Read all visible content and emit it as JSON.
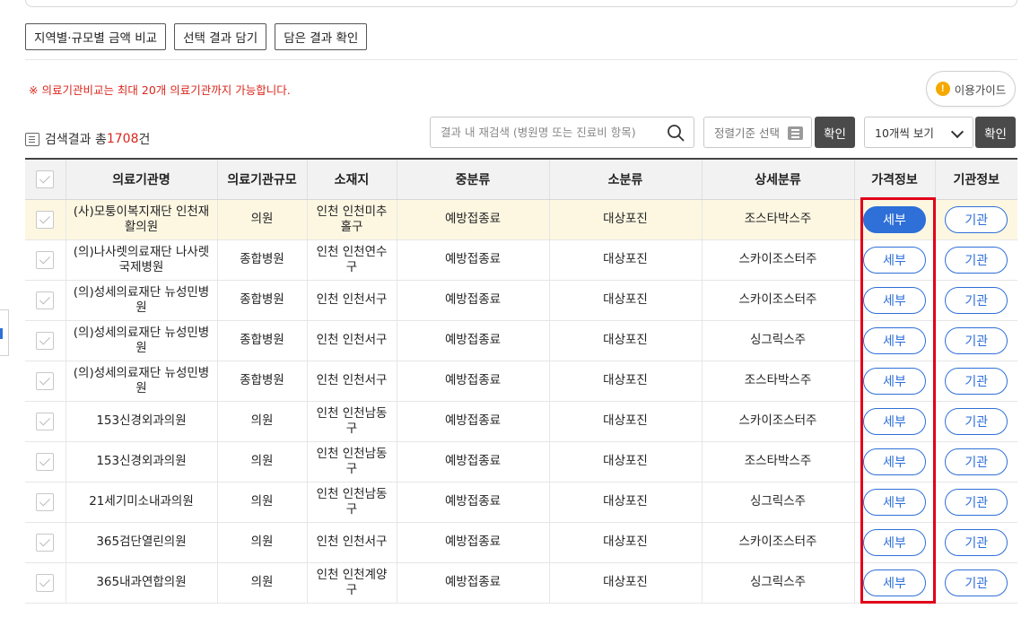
{
  "toolbar": {
    "compare_label": "지역별·규모별 금액 비교",
    "select_label": "선택 결과 담기",
    "view_label": "담은 결과 확인"
  },
  "notice": "※ 의료기관비교는 최대 20개 의료기관까지 가능합니다.",
  "guide": {
    "icon": "!",
    "label": "이용가이드"
  },
  "result": {
    "prefix": "검색결과 총",
    "count": "1708",
    "suffix": "건"
  },
  "search": {
    "placeholder": "결과 내 재검색 (병원명 또는 진료비 항목)"
  },
  "sort": {
    "placeholder": "정렬기준 선택",
    "confirm_label": "확인"
  },
  "perpage": {
    "selected": "10개씩 보기",
    "confirm_label": "확인"
  },
  "table": {
    "headers": [
      "의료기관명",
      "의료기관규모",
      "소재지",
      "중분류",
      "소분류",
      "상세분류",
      "가격정보",
      "기관정보"
    ],
    "detail_label": "세부",
    "org_label": "기관",
    "rows": [
      {
        "name": "(사)모퉁이복지재단 인천재활의원",
        "size": "의원",
        "location": "인천 인천미추홀구",
        "mid": "예방접종료",
        "small": "대상포진",
        "detail": "조스타박스주"
      },
      {
        "name": "(의)나사렛의료재단 나사렛국제병원",
        "size": "종합병원",
        "location": "인천 인천연수구",
        "mid": "예방접종료",
        "small": "대상포진",
        "detail": "스카이조스터주"
      },
      {
        "name": "(의)성세의료재단 뉴성민병원",
        "size": "종합병원",
        "location": "인천 인천서구",
        "mid": "예방접종료",
        "small": "대상포진",
        "detail": "스카이조스터주"
      },
      {
        "name": "(의)성세의료재단 뉴성민병원",
        "size": "종합병원",
        "location": "인천 인천서구",
        "mid": "예방접종료",
        "small": "대상포진",
        "detail": "싱그릭스주"
      },
      {
        "name": "(의)성세의료재단 뉴성민병원",
        "size": "종합병원",
        "location": "인천 인천서구",
        "mid": "예방접종료",
        "small": "대상포진",
        "detail": "조스타박스주"
      },
      {
        "name": "153신경외과의원",
        "size": "의원",
        "location": "인천 인천남동구",
        "mid": "예방접종료",
        "small": "대상포진",
        "detail": "스카이조스터주"
      },
      {
        "name": "153신경외과의원",
        "size": "의원",
        "location": "인천 인천남동구",
        "mid": "예방접종료",
        "small": "대상포진",
        "detail": "조스타박스주"
      },
      {
        "name": "21세기미소내과의원",
        "size": "의원",
        "location": "인천 인천남동구",
        "mid": "예방접종료",
        "small": "대상포진",
        "detail": "싱그릭스주"
      },
      {
        "name": "365검단열린의원",
        "size": "의원",
        "location": "인천 인천서구",
        "mid": "예방접종료",
        "small": "대상포진",
        "detail": "스카이조스터주"
      },
      {
        "name": "365내과연합의원",
        "size": "의원",
        "location": "인천 인천계양구",
        "mid": "예방접종료",
        "small": "대상포진",
        "detail": "싱그릭스주"
      }
    ]
  }
}
